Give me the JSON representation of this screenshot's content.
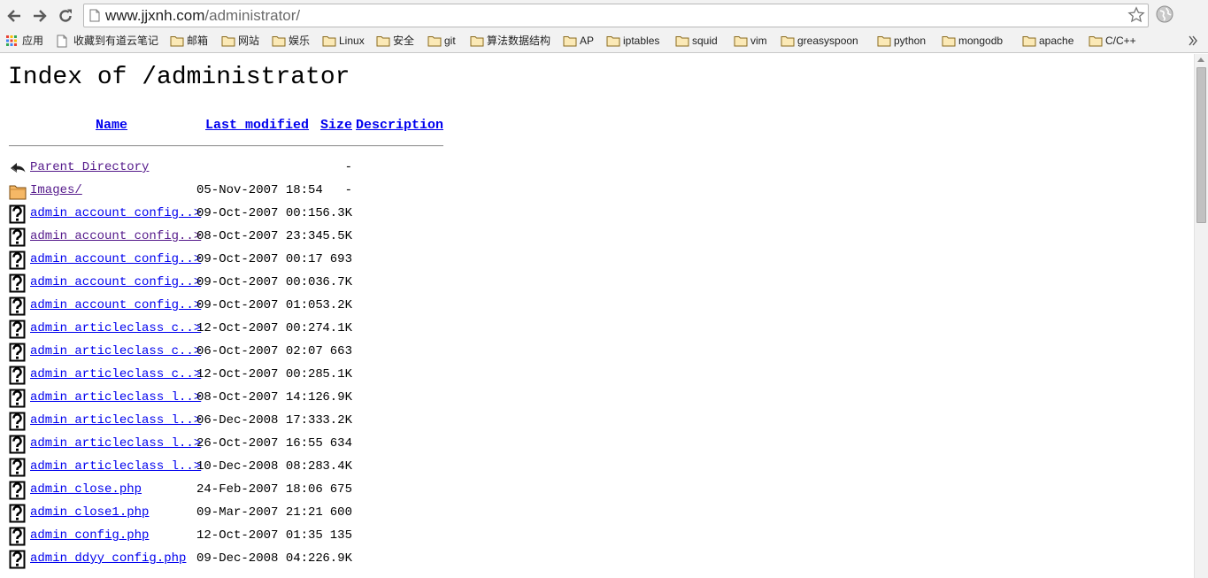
{
  "browser": {
    "url_host": "www.jjxnh.com",
    "url_path": "/administrator/"
  },
  "bookmarks": [
    {
      "label": "应用",
      "icon": "apps-grid-icon"
    },
    {
      "label": "收藏到有道云笔记",
      "icon": "page-icon"
    },
    {
      "label": "邮箱",
      "icon": "folder-icon"
    },
    {
      "label": "网站",
      "icon": "folder-icon"
    },
    {
      "label": "娱乐",
      "icon": "folder-icon"
    },
    {
      "label": "Linux",
      "icon": "folder-icon"
    },
    {
      "label": "安全",
      "icon": "folder-icon"
    },
    {
      "label": "git",
      "icon": "folder-icon"
    },
    {
      "label": "算法数据结构",
      "icon": "folder-icon"
    },
    {
      "label": "AP",
      "icon": "folder-icon"
    },
    {
      "label": "iptables",
      "icon": "folder-icon"
    },
    {
      "label": "squid",
      "icon": "folder-icon"
    },
    {
      "label": "vim",
      "icon": "folder-icon"
    },
    {
      "label": "greasyspoon",
      "icon": "folder-icon"
    },
    {
      "label": "python",
      "icon": "folder-icon"
    },
    {
      "label": "mongodb",
      "icon": "folder-icon"
    },
    {
      "label": "apache",
      "icon": "folder-icon"
    },
    {
      "label": "C/C++",
      "icon": "folder-icon"
    }
  ],
  "listing": {
    "title": "Index of /administrator",
    "columns": {
      "name": "Name",
      "modified": "Last modified",
      "size": "Size",
      "description": "Description"
    },
    "rows": [
      {
        "icon": "back-icon",
        "name": "Parent Directory",
        "modified": "",
        "size": "-",
        "visited": true
      },
      {
        "icon": "folder-icon",
        "name": "Images/",
        "modified": "05-Nov-2007 18:54",
        "size": "-",
        "visited": true
      },
      {
        "icon": "unknown-file-icon",
        "name": "admin_account_config..>",
        "modified": "09-Oct-2007 00:15",
        "size": "6.3K",
        "visited": false
      },
      {
        "icon": "unknown-file-icon",
        "name": "admin_account_config..>",
        "modified": "08-Oct-2007 23:34",
        "size": "5.5K",
        "visited": true
      },
      {
        "icon": "unknown-file-icon",
        "name": "admin_account_config..>",
        "modified": "09-Oct-2007 00:17",
        "size": "693",
        "visited": false
      },
      {
        "icon": "unknown-file-icon",
        "name": "admin_account_config..>",
        "modified": "09-Oct-2007 00:03",
        "size": "6.7K",
        "visited": false
      },
      {
        "icon": "unknown-file-icon",
        "name": "admin_account_config..>",
        "modified": "09-Oct-2007 01:05",
        "size": "3.2K",
        "visited": false
      },
      {
        "icon": "unknown-file-icon",
        "name": "admin_articleclass_c..>",
        "modified": "12-Oct-2007 00:27",
        "size": "4.1K",
        "visited": false
      },
      {
        "icon": "unknown-file-icon",
        "name": "admin_articleclass_c..>",
        "modified": "06-Oct-2007 02:07",
        "size": "663",
        "visited": false
      },
      {
        "icon": "unknown-file-icon",
        "name": "admin_articleclass_c..>",
        "modified": "12-Oct-2007 00:28",
        "size": "5.1K",
        "visited": false
      },
      {
        "icon": "unknown-file-icon",
        "name": "admin_articleclass_l..>",
        "modified": "08-Oct-2007 14:12",
        "size": "6.9K",
        "visited": false
      },
      {
        "icon": "unknown-file-icon",
        "name": "admin_articleclass_l..>",
        "modified": "06-Dec-2008 17:33",
        "size": "3.2K",
        "visited": false
      },
      {
        "icon": "unknown-file-icon",
        "name": "admin_articleclass_l..>",
        "modified": "26-Oct-2007 16:55",
        "size": "634",
        "visited": false
      },
      {
        "icon": "unknown-file-icon",
        "name": "admin_articleclass_l..>",
        "modified": "10-Dec-2008 08:28",
        "size": "3.4K",
        "visited": false
      },
      {
        "icon": "unknown-file-icon",
        "name": "admin_close.php",
        "modified": "24-Feb-2007 18:06",
        "size": "675",
        "visited": false
      },
      {
        "icon": "unknown-file-icon",
        "name": "admin_close1.php",
        "modified": "09-Mar-2007 21:21",
        "size": "600",
        "visited": false
      },
      {
        "icon": "unknown-file-icon",
        "name": "admin_config.php",
        "modified": "12-Oct-2007 01:35",
        "size": "135",
        "visited": false
      },
      {
        "icon": "unknown-file-icon",
        "name": "admin_ddyy_config.php",
        "modified": "09-Dec-2008 04:22",
        "size": "6.9K",
        "visited": false
      }
    ]
  }
}
